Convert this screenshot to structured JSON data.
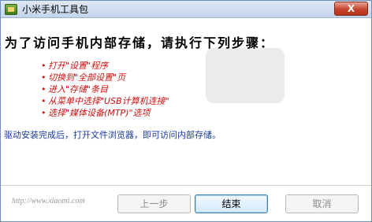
{
  "window": {
    "title": "小米手机工具包",
    "close_label": "X",
    "colors": {
      "accent": "#cc1111",
      "info": "#1a3aa0",
      "titlebar": "#c4d5ea"
    }
  },
  "icons": {
    "app": "toolbox-icon",
    "close": "close-icon"
  },
  "content": {
    "headline": "为了访问手机内部存储，请执行下列步骤：",
    "steps": [
      "打开\"设置\"程序",
      "切换到\"全部设置\"页",
      "进入\"存储\"条目",
      "从菜单中选择\"USB计算机连接\"",
      "选择\"媒体设备(MTP)\"选项"
    ],
    "info_text": "驱动安装完成后，打开文件浏览器，即可访问内部存储。"
  },
  "footer": {
    "url": "http://www.xiaomi.com",
    "prev_label": "上一步",
    "finish_label": "结束",
    "cancel_label": "取消"
  }
}
